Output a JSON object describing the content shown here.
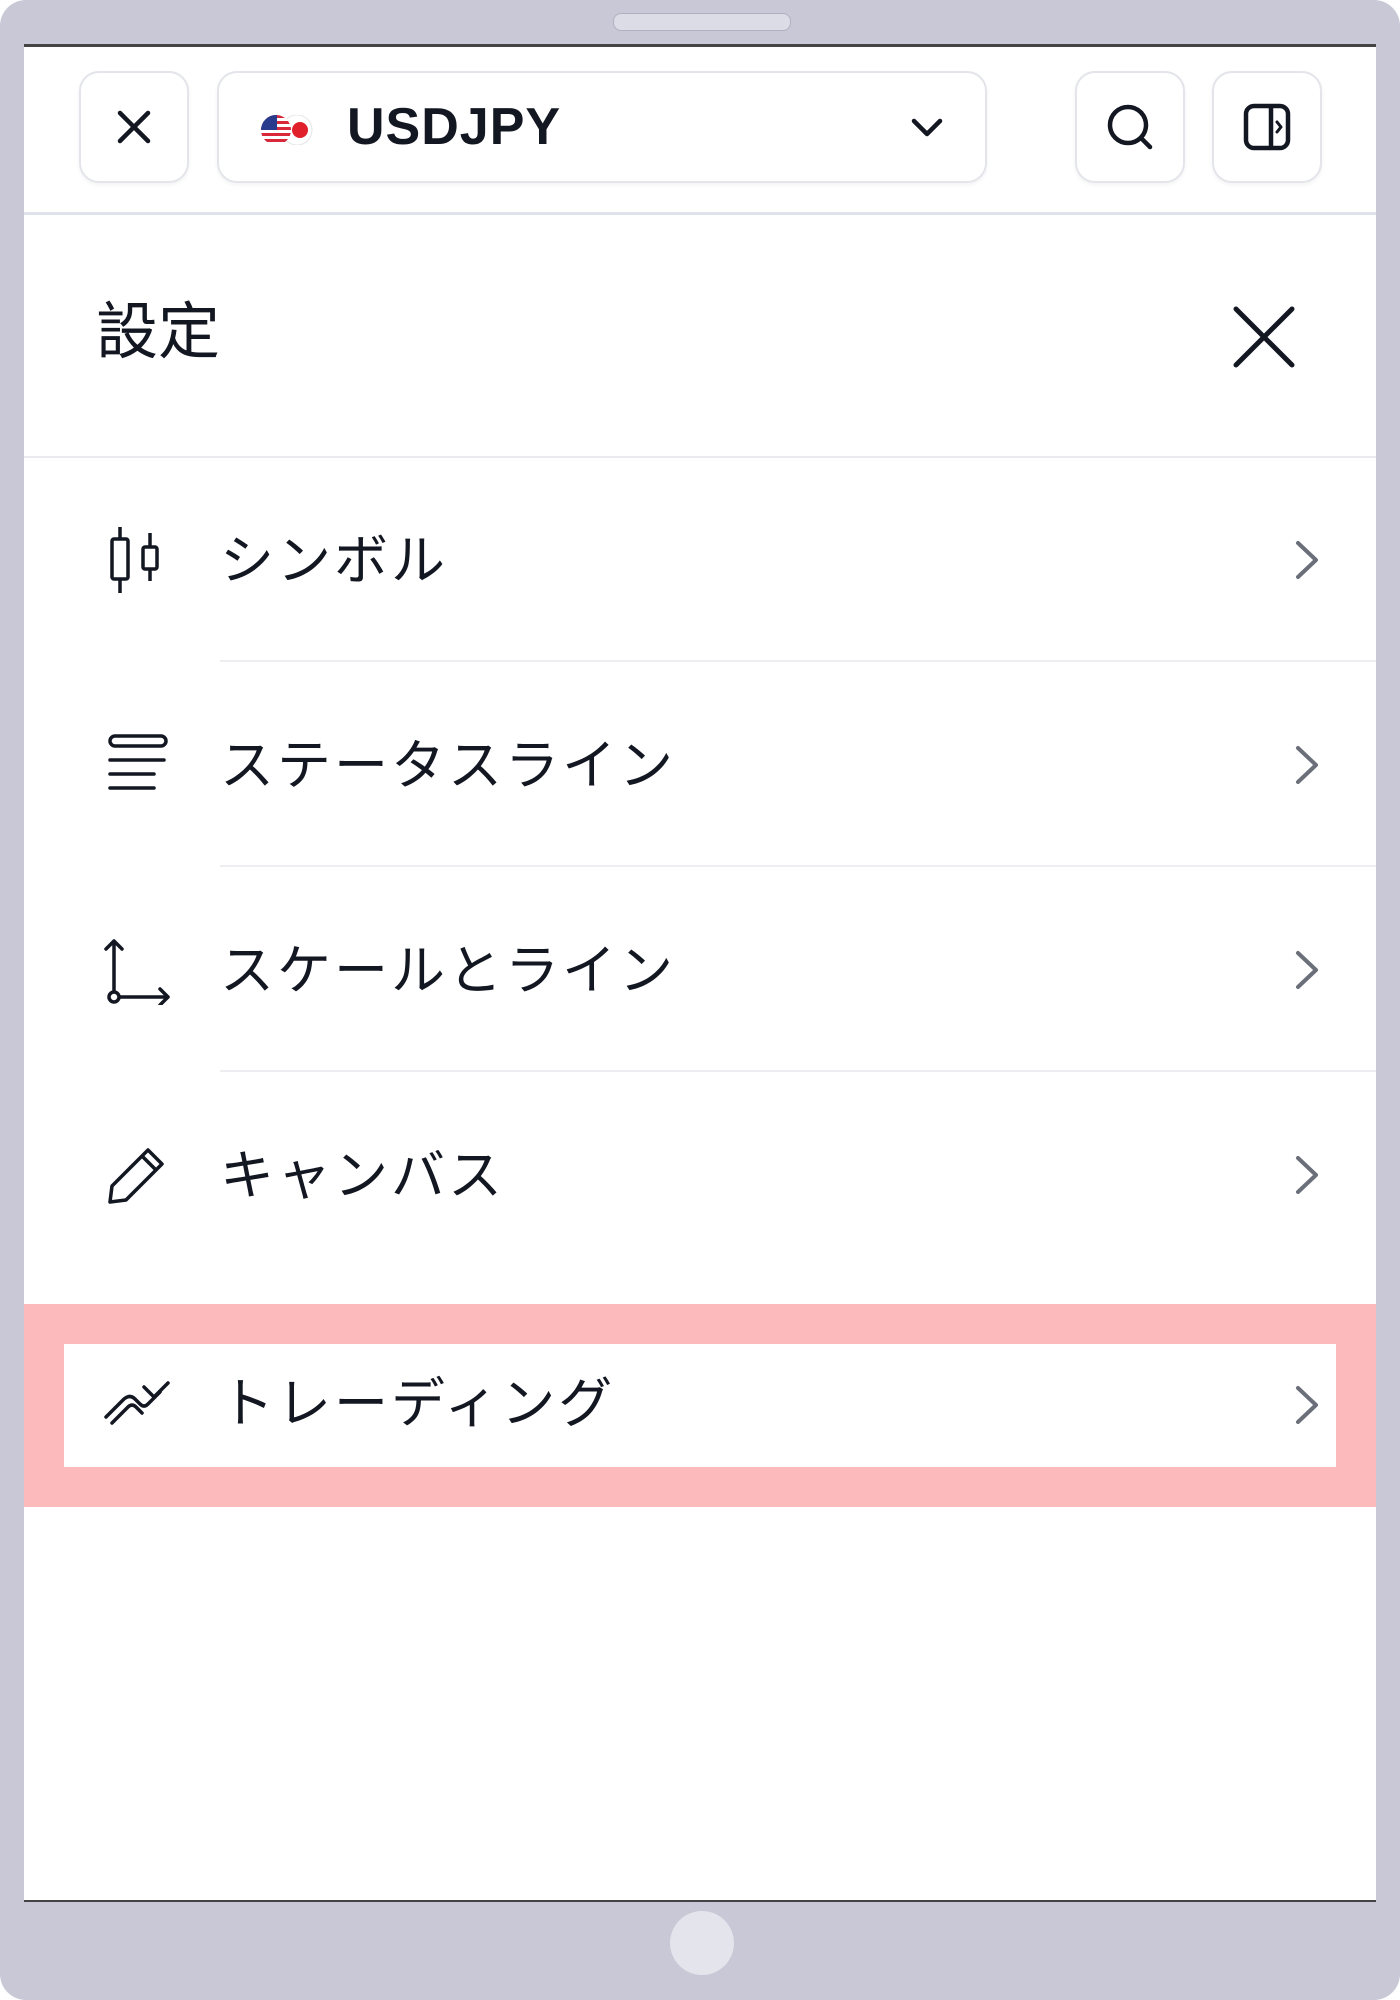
{
  "toolbar": {
    "symbol": "USDJPY"
  },
  "settings": {
    "title": "設定",
    "items": [
      {
        "label": "シンボル",
        "icon": "candlestick-icon"
      },
      {
        "label": "ステータスライン",
        "icon": "status-line-icon"
      },
      {
        "label": "スケールとライン",
        "icon": "scales-icon"
      },
      {
        "label": "キャンバス",
        "icon": "pencil-icon"
      },
      {
        "label": "トレーディング",
        "icon": "trading-icon",
        "highlighted": true
      }
    ]
  },
  "colors": {
    "highlight": "#fdbabc",
    "text": "#131722",
    "device_frame": "#c8c8d6"
  }
}
